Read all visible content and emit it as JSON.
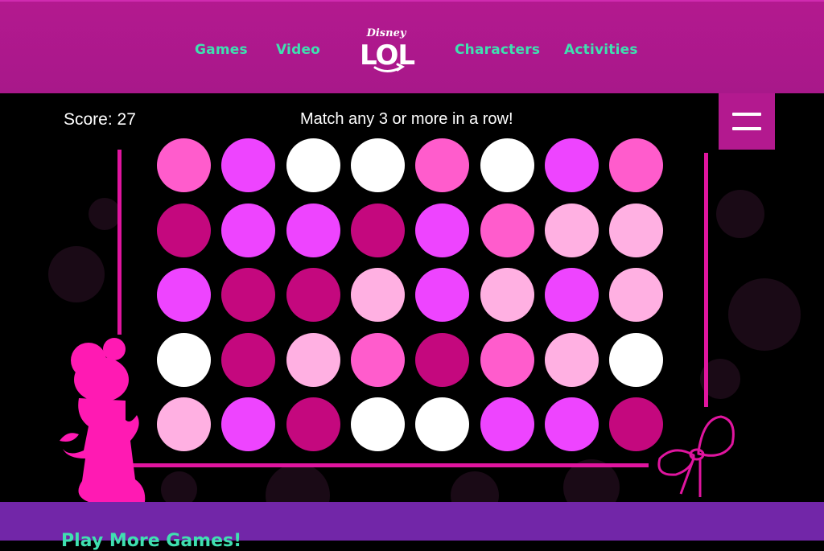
{
  "nav": {
    "links": [
      "Games",
      "Video",
      "Characters",
      "Activities"
    ],
    "logo": {
      "brand": "Disney",
      "word": "LOL"
    }
  },
  "game": {
    "score_label": "Score:",
    "score": "27",
    "instructions": "Match any 3 or more in a row!",
    "menu_icon": "hamburger-icon",
    "grid": [
      [
        "pink",
        "violet",
        "white",
        "white",
        "pink",
        "white",
        "violet",
        "pink"
      ],
      [
        "magenta",
        "violet",
        "violet",
        "magenta",
        "violet",
        "pink",
        "lightpink",
        "lightpink"
      ],
      [
        "violet",
        "magenta",
        "magenta",
        "lightpink",
        "violet",
        "lightpink",
        "violet",
        "lightpink"
      ],
      [
        "white",
        "magenta",
        "lightpink",
        "pink",
        "magenta",
        "pink",
        "lightpink",
        "white"
      ],
      [
        "lightpink",
        "violet",
        "magenta",
        "white",
        "white",
        "violet",
        "violet",
        "magenta"
      ]
    ],
    "colors": {
      "pink": "#ff5ccc",
      "violet": "#ee44ff",
      "white": "#ffffff",
      "magenta": "#c4087e",
      "lightpink": "#ffb0e2",
      "frame": "#e0159f"
    }
  },
  "footer": {
    "title": "Play More Games!"
  }
}
